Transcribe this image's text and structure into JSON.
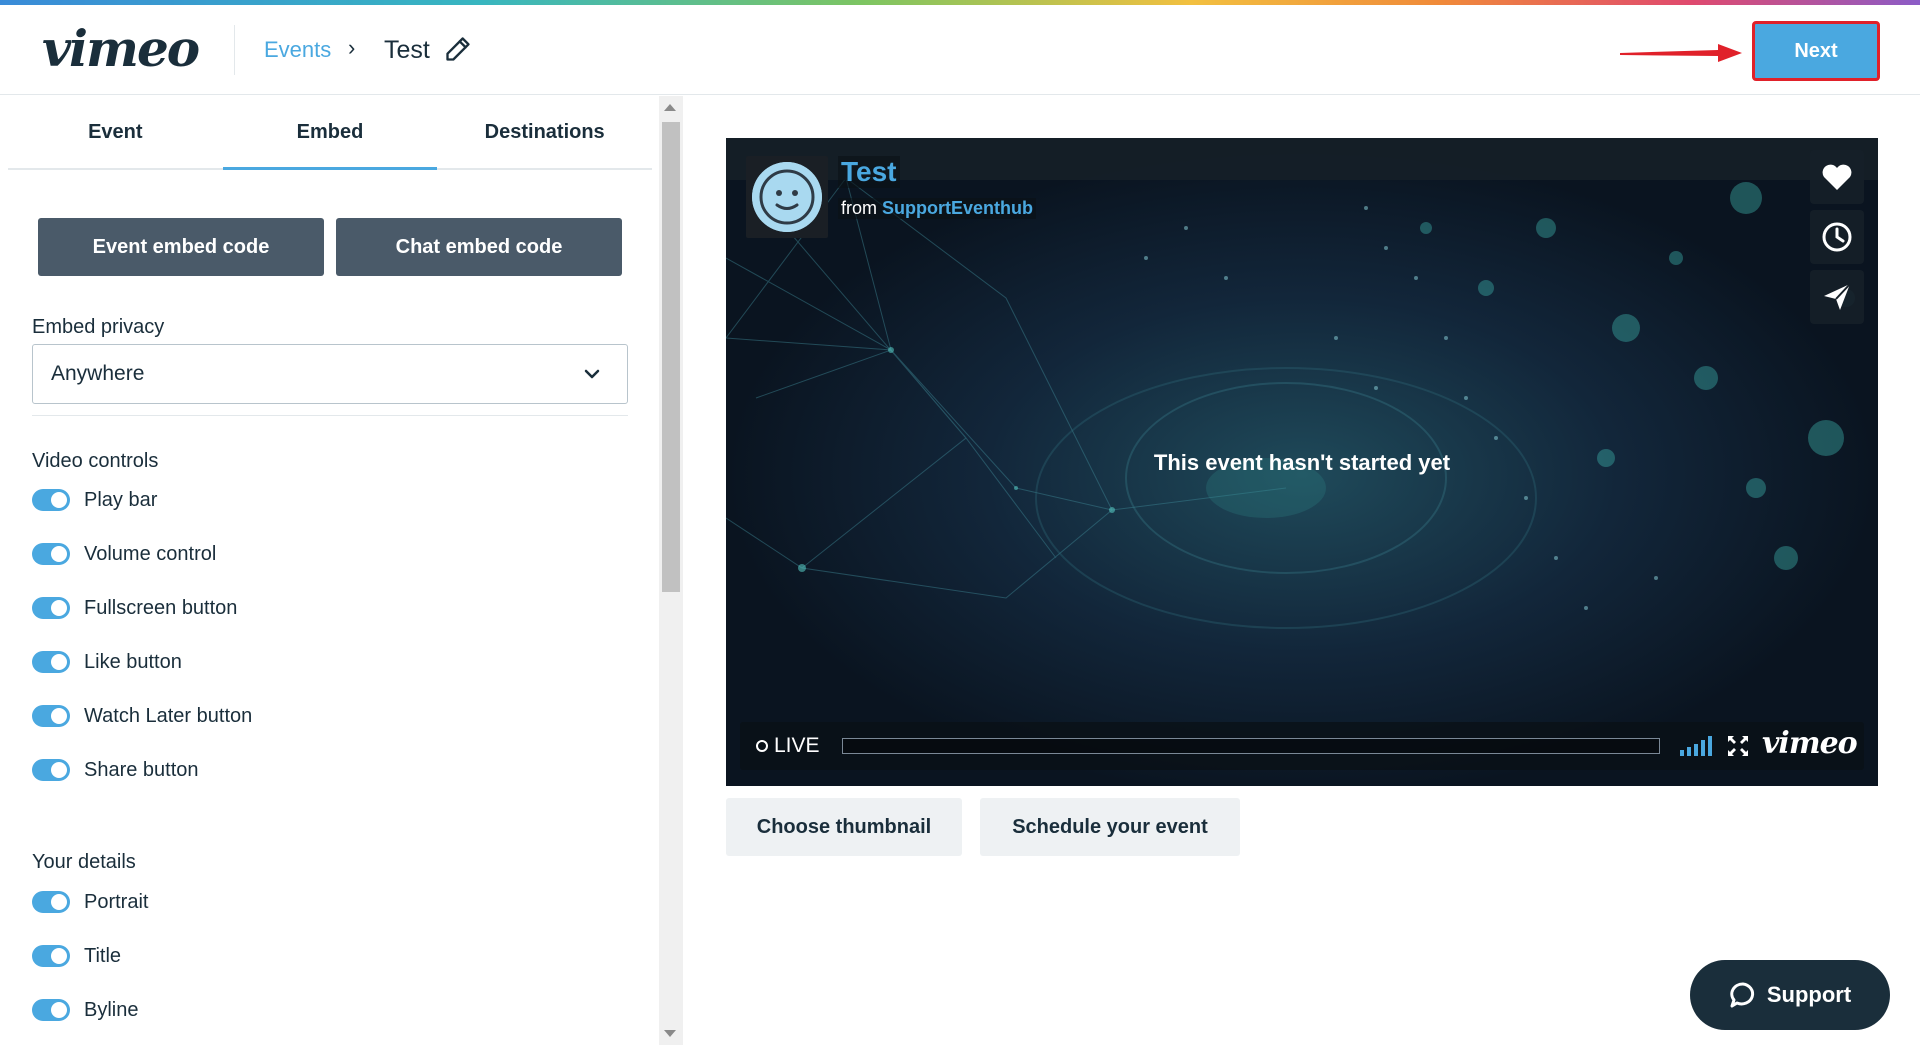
{
  "header": {
    "logo": "vimeo",
    "breadcrumb_events": "Events",
    "breadcrumb_separator": "›",
    "breadcrumb_title": "Test",
    "next_label": "Next",
    "accent_color": "#4aa8e0",
    "annotation_color": "#e0212a"
  },
  "left_panel": {
    "tabs": [
      {
        "label": "Event",
        "active": false
      },
      {
        "label": "Embed",
        "active": true
      },
      {
        "label": "Destinations",
        "active": false
      }
    ],
    "event_embed_label": "Event embed code",
    "chat_embed_label": "Chat embed code",
    "privacy_label": "Embed privacy",
    "privacy_value": "Anywhere",
    "video_controls_heading": "Video controls",
    "video_controls": [
      {
        "label": "Play bar",
        "on": true
      },
      {
        "label": "Volume control",
        "on": true
      },
      {
        "label": "Fullscreen button",
        "on": true
      },
      {
        "label": "Like button",
        "on": true
      },
      {
        "label": "Watch Later button",
        "on": true
      },
      {
        "label": "Share button",
        "on": true
      }
    ],
    "details_heading": "Your details",
    "details": [
      {
        "label": "Portrait",
        "on": true
      },
      {
        "label": "Title",
        "on": true
      },
      {
        "label": "Byline",
        "on": true
      }
    ]
  },
  "player": {
    "title": "Test",
    "byline_prefix": "from",
    "byline_user": "SupportEventhub",
    "message": "This event hasn't started yet",
    "live_label": "LIVE",
    "logo": "vimeo",
    "side_buttons": [
      "heart-icon",
      "clock-icon",
      "send-icon"
    ]
  },
  "actions": {
    "choose_thumbnail": "Choose thumbnail",
    "schedule_event": "Schedule your event"
  },
  "support": {
    "label": "Support"
  }
}
